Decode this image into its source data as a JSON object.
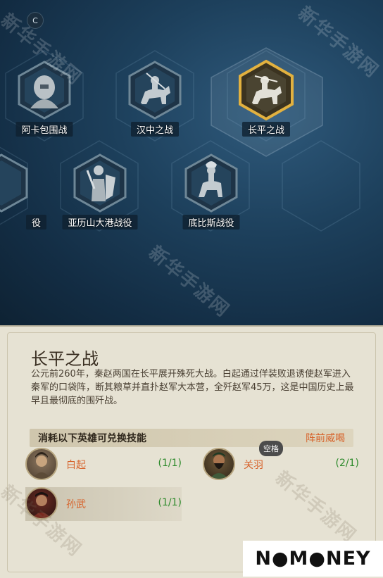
{
  "top_button": "C",
  "battles": [
    {
      "id": "akka",
      "label": "阿卡包围战",
      "icon": "warrior-bust-icon",
      "selected": false
    },
    {
      "id": "hanzhong",
      "label": "汉中之战",
      "icon": "cavalry-icon",
      "selected": false
    },
    {
      "id": "changping",
      "label": "长平之战",
      "icon": "cavalry-icon",
      "selected": true
    },
    {
      "id": "partial",
      "label": "役",
      "icon": "",
      "selected": false
    },
    {
      "id": "alexandria",
      "label": "亚历山大港战役",
      "icon": "shield-warrior-icon",
      "selected": false
    },
    {
      "id": "thebes",
      "label": "底比斯战役",
      "icon": "cavalry-icon",
      "selected": false
    }
  ],
  "watermark": "新华手游网",
  "panel": {
    "title": "长平之战",
    "description": "公元前260年，秦赵两国在长平展开殊死大战。白起通过佯装败退诱使赵军进入秦军的口袋阵，断其粮草并直扑赵军大本营，全歼赵军45万，这是中国历史上最早且最彻底的围歼战。",
    "exchange_label": "消耗以下英雄可兑换技能",
    "skill_name": "阵前威喝",
    "tooltip": "空格",
    "heroes": [
      {
        "name": "白起",
        "count": "(1/1)"
      },
      {
        "name": "关羽",
        "count": "(2/1)"
      },
      {
        "name": "孙武",
        "count": "(1/1)"
      }
    ]
  },
  "logo": "N●M●NEY",
  "colors": {
    "accent_orange": "#d7632b",
    "count_green": "#2d8a2b",
    "selected_gold": "#e2b13f"
  }
}
